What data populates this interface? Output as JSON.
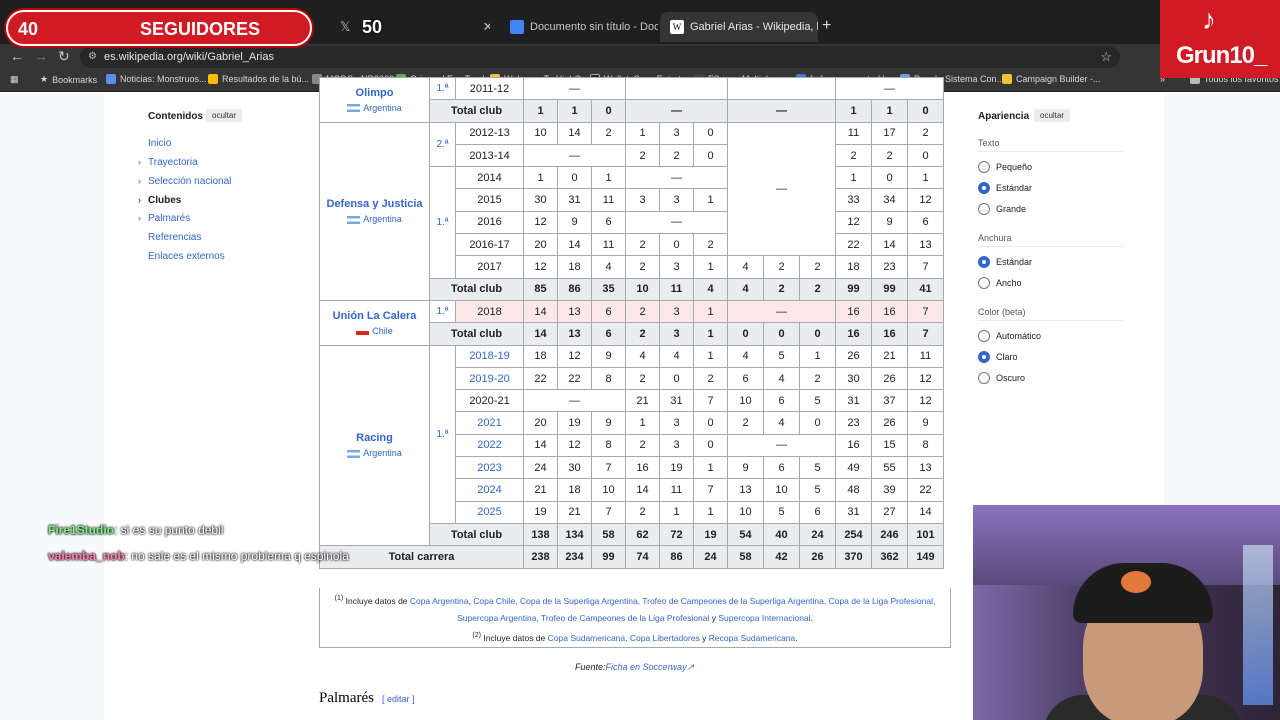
{
  "overlay": {
    "followers_count": "40",
    "followers_label": "SEGUIDORES",
    "followers_goal": "50",
    "tiktok_name": "Grun10_"
  },
  "tabs": [
    {
      "title": "Documento sin título - Docume",
      "color": "#4285f4"
    },
    {
      "title": "Gabriel Arias - Wikipedia, la enc",
      "color": "#ffffff"
    }
  ],
  "address": {
    "url": "es.wikipedia.org/wiki/Gabriel_Arias"
  },
  "bookmarks": [
    {
      "label": "Bookmarks",
      "color": "#bbbbbb"
    },
    {
      "label": "Noticias: Monstruos...",
      "color": "#5b8def"
    },
    {
      "label": "Resultados de la bú...",
      "color": "#fbbc05"
    },
    {
      "label": "MODS - NR2003",
      "color": "#888888"
    },
    {
      "label": "Grip and Fun Tracks",
      "color": "#6aa84f"
    },
    {
      "label": "Welcome To HighGr...",
      "color": "#f1c232"
    },
    {
      "label": "Wallet: Sony Enterta...",
      "color": "#222222"
    },
    {
      "label": "FSopen Multiplayer...",
      "color": "#444444"
    },
    {
      "label": "fs-freeware.net - Ho...",
      "color": "#3c78d8"
    },
    {
      "label": "Papel - Sistema Con...",
      "color": "#6d9eeb"
    },
    {
      "label": "Campaign Builder -...",
      "color": "#f1c232"
    },
    {
      "label": "Todos los favoritos",
      "color": "#bbbbbb"
    }
  ],
  "toc": {
    "title": "Contenidos",
    "hide": "ocultar",
    "items": [
      "Inicio",
      "Trayectoria",
      "Selección nacional",
      "Clubes",
      "Palmarés",
      "Referencias",
      "Enlaces externos"
    ]
  },
  "appearance": {
    "title": "Apariencia",
    "hide": "ocultar",
    "text_label": "Texto",
    "text_options": [
      "Pequeño",
      "Estándar",
      "Grande"
    ],
    "width_label": "Anchura",
    "width_options": [
      "Estándar",
      "Ancho"
    ],
    "color_label": "Color (beta)",
    "color_options": [
      "Automático",
      "Claro",
      "Oscuro"
    ]
  },
  "table": {
    "clubs": {
      "olimpo": {
        "name": "Olimpo",
        "country": "Argentina",
        "division": "1.ª"
      },
      "defensa": {
        "name": "Defensa y Justicia",
        "country": "Argentina",
        "div_a": "2.ª",
        "div_b": "1.ª"
      },
      "union": {
        "name": "Unión La Calera",
        "country": "Chile",
        "division": "1.ª"
      },
      "racing": {
        "name": "Racing",
        "country": "Argentina",
        "division": "1.ª"
      }
    },
    "total_label": "Total club",
    "dash": "—",
    "olimpo_rows": [
      {
        "season": "2011-12"
      }
    ],
    "olimpo_total": [
      "1",
      "1",
      "0",
      "1",
      "1",
      "0"
    ],
    "defensa_rows": [
      {
        "season": "2012-13",
        "v": [
          "10",
          "14",
          "2",
          "1",
          "3",
          "0",
          "11",
          "17",
          "2"
        ]
      },
      {
        "season": "2013-14",
        "v": [
          "2",
          "2",
          "0",
          "2",
          "2",
          "0"
        ]
      },
      {
        "season": "2014",
        "v": [
          "1",
          "0",
          "1",
          "1",
          "0",
          "1"
        ]
      },
      {
        "season": "2015",
        "v": [
          "30",
          "31",
          "11",
          "3",
          "3",
          "1",
          "33",
          "34",
          "12"
        ]
      },
      {
        "season": "2016",
        "v": [
          "12",
          "9",
          "6",
          "12",
          "9",
          "6"
        ]
      },
      {
        "season": "2016-17",
        "v": [
          "20",
          "14",
          "11",
          "2",
          "0",
          "2",
          "22",
          "14",
          "13"
        ]
      },
      {
        "season": "2017",
        "v": [
          "12",
          "18",
          "4",
          "2",
          "3",
          "1",
          "4",
          "2",
          "2",
          "18",
          "23",
          "7"
        ]
      }
    ],
    "defensa_total": [
      "85",
      "86",
      "35",
      "10",
      "11",
      "4",
      "4",
      "2",
      "2",
      "99",
      "99",
      "41"
    ],
    "union_rows": [
      {
        "season": "2018",
        "v": [
          "14",
          "13",
          "6",
          "2",
          "3",
          "1",
          "16",
          "16",
          "7"
        ]
      }
    ],
    "union_total": [
      "14",
      "13",
      "6",
      "2",
      "3",
      "1",
      "0",
      "0",
      "0",
      "16",
      "16",
      "7"
    ],
    "racing_rows": [
      {
        "season": "2018-19",
        "v": [
          "18",
          "12",
          "9",
          "4",
          "4",
          "1",
          "4",
          "5",
          "1",
          "26",
          "21",
          "11"
        ]
      },
      {
        "season": "2019-20",
        "v": [
          "22",
          "22",
          "8",
          "2",
          "0",
          "2",
          "6",
          "4",
          "2",
          "30",
          "26",
          "12"
        ]
      },
      {
        "season": "2020-21",
        "v": [
          "21",
          "31",
          "7",
          "10",
          "6",
          "5",
          "31",
          "37",
          "12"
        ]
      },
      {
        "season": "2021",
        "v": [
          "20",
          "19",
          "9",
          "1",
          "3",
          "0",
          "2",
          "4",
          "0",
          "23",
          "26",
          "9"
        ]
      },
      {
        "season": "2022",
        "v": [
          "14",
          "12",
          "8",
          "2",
          "3",
          "0",
          "16",
          "15",
          "8"
        ]
      },
      {
        "season": "2023",
        "v": [
          "24",
          "30",
          "7",
          "16",
          "19",
          "1",
          "9",
          "6",
          "5",
          "49",
          "55",
          "13"
        ]
      },
      {
        "season": "2024",
        "v": [
          "21",
          "18",
          "10",
          "14",
          "11",
          "7",
          "13",
          "10",
          "5",
          "48",
          "39",
          "22"
        ]
      },
      {
        "season": "2025",
        "v": [
          "19",
          "21",
          "7",
          "2",
          "1",
          "1",
          "10",
          "5",
          "6",
          "31",
          "27",
          "14"
        ]
      }
    ],
    "racing_total": [
      "138",
      "134",
      "58",
      "62",
      "72",
      "19",
      "54",
      "40",
      "24",
      "254",
      "246",
      "101"
    ],
    "career_label": "Total carrera",
    "career_total": [
      "238",
      "234",
      "99",
      "74",
      "86",
      "24",
      "58",
      "42",
      "26",
      "370",
      "362",
      "149"
    ]
  },
  "notes": {
    "n1_mark": "(1)",
    "n1_pre": " Incluye datos de ",
    "n1_links": "Copa Argentina, Copa Chile, Copa de la Superliga Argentina, Trofeo de Campeones de la Superliga Argentina, Copa de la Liga Profesional, Supercopa Argentina, Trofeo de Campeones de la Liga Profesional",
    "n1_and": " y ",
    "n1_last": "Supercopa Internacional",
    "n2_mark": "(2)",
    "n2_pre": " Incluye datos de ",
    "n2_links": "Copa Sudamericana, Copa Libertadores",
    "n2_and": " y ",
    "n2_last": "Recopa Sudamericana"
  },
  "source": {
    "label": "Fuente:",
    "link": "Ficha en Soccerway"
  },
  "palmares": {
    "title": "Palmarés",
    "edit": "[ editar ]"
  },
  "chat": [
    {
      "user": "Fire1Studio",
      "msg": ": si es su punto debil"
    },
    {
      "user": "valemba_nob",
      "msg": ": no sale es el mismo problema q espinola"
    }
  ]
}
